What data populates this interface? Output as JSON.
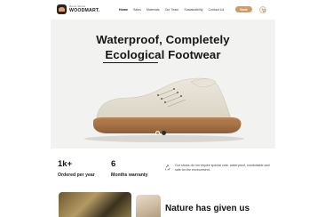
{
  "header": {
    "logo_tagline": "Hemp Shoes",
    "logo_name": "WOODMART.",
    "nav": [
      "Home",
      "Sales",
      "Materials",
      "Our Team",
      "Sustainability",
      "Contact Us"
    ],
    "active_nav": "Home",
    "cta_label": "Book",
    "cart_count": "0"
  },
  "hero": {
    "title_line1": "Waterproof, Completely",
    "title_line2": "Ecological  Footwear",
    "slider_dots": 3,
    "active_slide": 1,
    "colors": {
      "background": "#f2f2f0",
      "accent": "#d49a64"
    }
  },
  "stats": [
    {
      "value": "1k+",
      "label": "Ordered per year"
    },
    {
      "value": "6",
      "label": "Months warranty"
    }
  ],
  "description": "Our shoes do not require special care, waterproof, comfortable and safe for the environment.",
  "section2": {
    "heading": "Nature has given us"
  },
  "icons": {
    "logo": "shoe-logo-icon",
    "cart": "cart-icon",
    "eco": "recycle-icon"
  }
}
